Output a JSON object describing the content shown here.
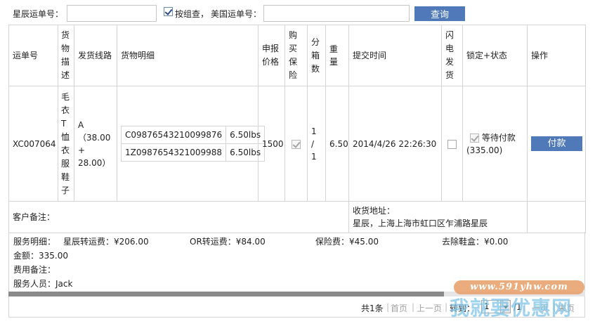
{
  "search": {
    "star_label": "星辰运单号：",
    "star_value": "",
    "group_check_label": "按组查，",
    "group_checked": true,
    "us_label": "美国运单号：",
    "us_value": "",
    "search_button": "查询"
  },
  "table": {
    "headers": {
      "waybill": "运单号",
      "desc": "货物描述",
      "route": "发货线路",
      "detail": "货物明细",
      "declared": "申报价格",
      "insure": "购买保险",
      "boxes": "分箱数",
      "weight": "重量",
      "submit_time": "提交时间",
      "flash": "闪电发货",
      "lock_status": "锁定+状态",
      "action": "操作"
    },
    "row": {
      "waybill": "XC007064",
      "desc": "毛衣T恤衣服鞋子",
      "route_a": "A（38.00",
      "route_b": "+",
      "route_c": "28.00）",
      "items": [
        {
          "code": "C09876543210099876",
          "weight": "6.50lbs"
        },
        {
          "code": "1Z0987654321009988",
          "weight": "6.50lbs"
        }
      ],
      "declared": "1500",
      "insured": true,
      "boxes_1": "1",
      "boxes_2": "/",
      "boxes_3": "1",
      "weight": "6.50",
      "submit_time": "2014/4/26 22:26:30",
      "flash": false,
      "locked": true,
      "status": "等待付款",
      "status_amount": "(335.00)",
      "pay_button": "付款"
    },
    "notes": {
      "customer_label": "客户备注：",
      "address_label": "收货地址：",
      "address_value": "星辰，上海上海市虹口区乍浦路星辰"
    }
  },
  "service": {
    "detail_label": "服务明细：",
    "star_fee": "星辰转运费：¥206.00",
    "or_fee": "OR转运费：¥84.00",
    "insurance_fee": "保险费：¥45.00",
    "shoebox_fee": "去除鞋盒：¥0.00",
    "total": "金额：335.00",
    "fee_note": "费用备注：",
    "staff": "服务人员：Jack"
  },
  "pager": {
    "total": "共1条",
    "first": "首页",
    "prev": "上一页",
    "goto": "转到：",
    "page": "1",
    "of": "/1",
    "next": "一页",
    "last": "末页"
  },
  "watermark": {
    "url": "www.591yhw.com",
    "text": "我就要优惠网"
  }
}
